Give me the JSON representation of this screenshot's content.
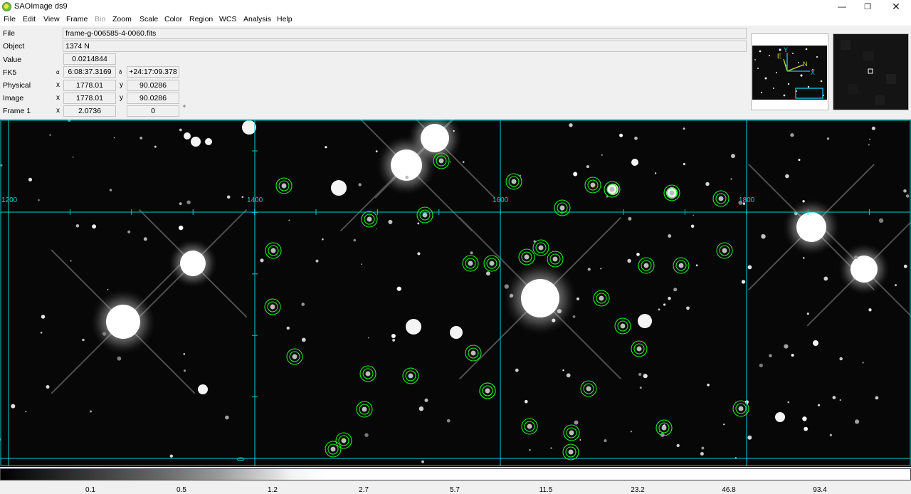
{
  "window": {
    "title": "SAOImage ds9",
    "min_icon": "minimize-icon",
    "max_icon": "restore-icon",
    "close_icon": "close-icon"
  },
  "menu": [
    "File",
    "Edit",
    "View",
    "Frame",
    "Bin",
    "Zoom",
    "Scale",
    "Color",
    "Region",
    "WCS",
    "Analysis",
    "Help"
  ],
  "menu_disabled": [
    "Bin"
  ],
  "info": {
    "file_label": "File",
    "file_value": "frame-g-006585-4-0060.fits",
    "object_label": "Object",
    "object_value": "1374 N",
    "value_label": "Value",
    "value_value": "0.0214844",
    "fk5_label": "FK5",
    "alpha_symbol": "α",
    "alpha_value": "6:08:37.3169",
    "delta_symbol": "δ",
    "delta_value": "+24:17:09.378",
    "physical_label": "Physical",
    "physical_x_label": "x",
    "physical_x": "1778.01",
    "physical_y_label": "y",
    "physical_y": "90.0286",
    "image_label": "Image",
    "image_x_label": "x",
    "image_x": "1778.01",
    "image_y_label": "y",
    "image_y": "90.0286",
    "frame_label": "Frame 1",
    "frame_x_label": "x",
    "frame_zoom": "2.0736",
    "frame_angle": "0",
    "degree_symbol": "°"
  },
  "panner": {
    "compass_north": "N",
    "compass_east": "E",
    "axis_x": "X",
    "axis_y": "Y"
  },
  "grid": {
    "color": "#00cccc",
    "labels": [
      "1200",
      "1400",
      "1600",
      "1800"
    ]
  },
  "regions": {
    "color": "#22ee22",
    "shape": "circle",
    "count": 38
  },
  "colorbar": {
    "ticks": [
      "0.1",
      "0.5",
      "1.2",
      "2.7",
      "5.7",
      "11.5",
      "23.2",
      "46.8",
      "93.4"
    ]
  }
}
